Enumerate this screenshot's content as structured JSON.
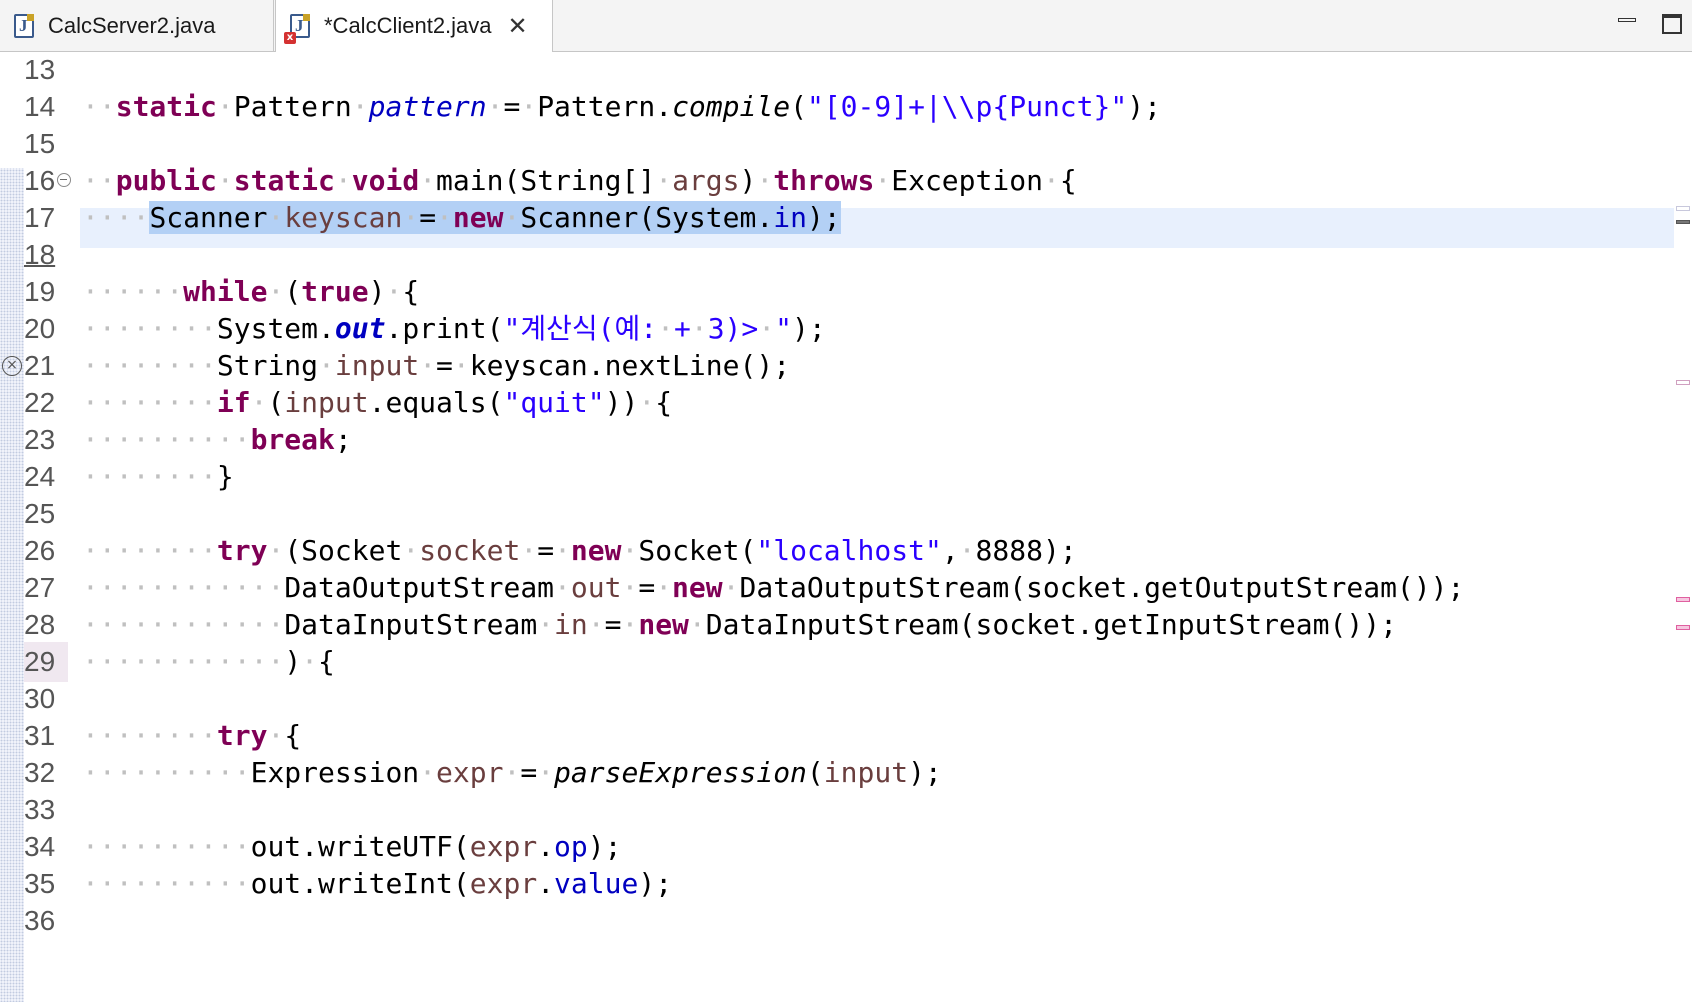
{
  "tabs": [
    {
      "label": "CalcServer2.java",
      "active": false,
      "dirty": false
    },
    {
      "label": "*CalcClient2.java",
      "active": true,
      "dirty": true,
      "has_error": true
    }
  ],
  "editor": {
    "current_line": 17,
    "lines": [
      {
        "num": "13",
        "html": ""
      },
      {
        "num": "14",
        "html": "··<span class='kw'>static</span>·Pattern·<span class='sfld' style='font-weight:normal'>pattern</span>·=·Pattern.<span class='smeth'>compile</span>(<span class='str'>\"[0-9]+|\\\\p{Punct}\"</span>);"
      },
      {
        "num": "15",
        "html": ""
      },
      {
        "num": "16",
        "html": "··<span class='kw'>public</span>·<span class='kw'>static</span>·<span class='kw'>void</span>·main(String[]·<span class='loc'>args</span>)·<span class='kw'>throws</span>·Exception·{"
      },
      {
        "num": "17",
        "html": "····<span class='sel'>Scanner·<span class='loc'>keyscan</span>·=·<span class='kw'>new</span>·Scanner(System.<span class='fld'>in</span>);</span>"
      },
      {
        "num": "18",
        "html": ""
      },
      {
        "num": "19",
        "html": "······<span class='kw'>while</span>·(<span class='kw'>true</span>)·{"
      },
      {
        "num": "20",
        "html": "········System.<span class='sfld'>out</span>.print(<span class='str'>\"계산식(예:·+·3)>·\"</span>);"
      },
      {
        "num": "21",
        "html": "········String·<span class='loc'>input</span>·=·keyscan.nextLine();"
      },
      {
        "num": "22",
        "html": "········<span class='kw'>if</span>·(<span class='loc'>input</span>.equals(<span class='str'>\"quit\"</span>))·{"
      },
      {
        "num": "23",
        "html": "··········<span class='kw'>break</span>;"
      },
      {
        "num": "24",
        "html": "········}"
      },
      {
        "num": "25",
        "html": ""
      },
      {
        "num": "26",
        "html": "········<span class='kw'>try</span>·(Socket·<span class='loc'>socket</span>·=·<span class='kw'>new</span>·Socket(<span class='str'>\"localhost\"</span>,·8888);"
      },
      {
        "num": "27",
        "html": "············DataOutputStream·<span class='loc'>out</span>·=·<span class='kw'>new</span>·DataOutputStream(socket.getOutputStream());"
      },
      {
        "num": "28",
        "html": "············DataInputStream·<span class='loc'>in</span>·=·<span class='kw'>new</span>·DataInputStream(socket.getInputStream());"
      },
      {
        "num": "29",
        "html": "············)·{"
      },
      {
        "num": "30",
        "html": ""
      },
      {
        "num": "31",
        "html": "········<span class='kw'>try</span>·{"
      },
      {
        "num": "32",
        "html": "··········Expression·<span class='loc'>expr</span>·=·<span class='smeth'>parseExpression</span>(<span class='loc'>input</span>);"
      },
      {
        "num": "33",
        "html": ""
      },
      {
        "num": "34",
        "html": "··········out.writeUTF(<span class='loc'>expr</span>.<span class='fld'>op</span>);"
      },
      {
        "num": "35",
        "html": "··········out.writeInt(<span class='loc'>expr</span>.<span class='fld'>value</span>);"
      },
      {
        "num": "36",
        "html": ""
      }
    ]
  },
  "colors": {
    "keyword": "#7f0055",
    "string": "#2a00ff",
    "field": "#0000c0",
    "local_var": "#6a3e3e",
    "current_line": "#e8f0fd",
    "selection": "#b3d0f5"
  }
}
